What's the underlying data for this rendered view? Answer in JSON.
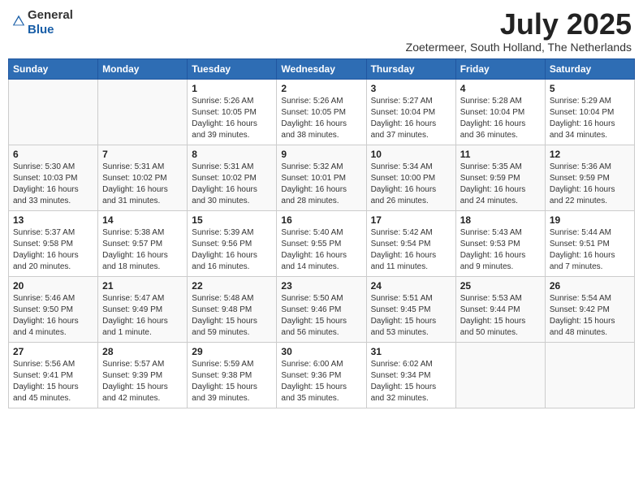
{
  "header": {
    "logo_general": "General",
    "logo_blue": "Blue",
    "month_title": "July 2025",
    "location": "Zoetermeer, South Holland, The Netherlands"
  },
  "days_of_week": [
    "Sunday",
    "Monday",
    "Tuesday",
    "Wednesday",
    "Thursday",
    "Friday",
    "Saturday"
  ],
  "weeks": [
    [
      {
        "day": "",
        "info": ""
      },
      {
        "day": "",
        "info": ""
      },
      {
        "day": "1",
        "info": "Sunrise: 5:26 AM\nSunset: 10:05 PM\nDaylight: 16 hours\nand 39 minutes."
      },
      {
        "day": "2",
        "info": "Sunrise: 5:26 AM\nSunset: 10:05 PM\nDaylight: 16 hours\nand 38 minutes."
      },
      {
        "day": "3",
        "info": "Sunrise: 5:27 AM\nSunset: 10:04 PM\nDaylight: 16 hours\nand 37 minutes."
      },
      {
        "day": "4",
        "info": "Sunrise: 5:28 AM\nSunset: 10:04 PM\nDaylight: 16 hours\nand 36 minutes."
      },
      {
        "day": "5",
        "info": "Sunrise: 5:29 AM\nSunset: 10:04 PM\nDaylight: 16 hours\nand 34 minutes."
      }
    ],
    [
      {
        "day": "6",
        "info": "Sunrise: 5:30 AM\nSunset: 10:03 PM\nDaylight: 16 hours\nand 33 minutes."
      },
      {
        "day": "7",
        "info": "Sunrise: 5:31 AM\nSunset: 10:02 PM\nDaylight: 16 hours\nand 31 minutes."
      },
      {
        "day": "8",
        "info": "Sunrise: 5:31 AM\nSunset: 10:02 PM\nDaylight: 16 hours\nand 30 minutes."
      },
      {
        "day": "9",
        "info": "Sunrise: 5:32 AM\nSunset: 10:01 PM\nDaylight: 16 hours\nand 28 minutes."
      },
      {
        "day": "10",
        "info": "Sunrise: 5:34 AM\nSunset: 10:00 PM\nDaylight: 16 hours\nand 26 minutes."
      },
      {
        "day": "11",
        "info": "Sunrise: 5:35 AM\nSunset: 9:59 PM\nDaylight: 16 hours\nand 24 minutes."
      },
      {
        "day": "12",
        "info": "Sunrise: 5:36 AM\nSunset: 9:59 PM\nDaylight: 16 hours\nand 22 minutes."
      }
    ],
    [
      {
        "day": "13",
        "info": "Sunrise: 5:37 AM\nSunset: 9:58 PM\nDaylight: 16 hours\nand 20 minutes."
      },
      {
        "day": "14",
        "info": "Sunrise: 5:38 AM\nSunset: 9:57 PM\nDaylight: 16 hours\nand 18 minutes."
      },
      {
        "day": "15",
        "info": "Sunrise: 5:39 AM\nSunset: 9:56 PM\nDaylight: 16 hours\nand 16 minutes."
      },
      {
        "day": "16",
        "info": "Sunrise: 5:40 AM\nSunset: 9:55 PM\nDaylight: 16 hours\nand 14 minutes."
      },
      {
        "day": "17",
        "info": "Sunrise: 5:42 AM\nSunset: 9:54 PM\nDaylight: 16 hours\nand 11 minutes."
      },
      {
        "day": "18",
        "info": "Sunrise: 5:43 AM\nSunset: 9:53 PM\nDaylight: 16 hours\nand 9 minutes."
      },
      {
        "day": "19",
        "info": "Sunrise: 5:44 AM\nSunset: 9:51 PM\nDaylight: 16 hours\nand 7 minutes."
      }
    ],
    [
      {
        "day": "20",
        "info": "Sunrise: 5:46 AM\nSunset: 9:50 PM\nDaylight: 16 hours\nand 4 minutes."
      },
      {
        "day": "21",
        "info": "Sunrise: 5:47 AM\nSunset: 9:49 PM\nDaylight: 16 hours\nand 1 minute."
      },
      {
        "day": "22",
        "info": "Sunrise: 5:48 AM\nSunset: 9:48 PM\nDaylight: 15 hours\nand 59 minutes."
      },
      {
        "day": "23",
        "info": "Sunrise: 5:50 AM\nSunset: 9:46 PM\nDaylight: 15 hours\nand 56 minutes."
      },
      {
        "day": "24",
        "info": "Sunrise: 5:51 AM\nSunset: 9:45 PM\nDaylight: 15 hours\nand 53 minutes."
      },
      {
        "day": "25",
        "info": "Sunrise: 5:53 AM\nSunset: 9:44 PM\nDaylight: 15 hours\nand 50 minutes."
      },
      {
        "day": "26",
        "info": "Sunrise: 5:54 AM\nSunset: 9:42 PM\nDaylight: 15 hours\nand 48 minutes."
      }
    ],
    [
      {
        "day": "27",
        "info": "Sunrise: 5:56 AM\nSunset: 9:41 PM\nDaylight: 15 hours\nand 45 minutes."
      },
      {
        "day": "28",
        "info": "Sunrise: 5:57 AM\nSunset: 9:39 PM\nDaylight: 15 hours\nand 42 minutes."
      },
      {
        "day": "29",
        "info": "Sunrise: 5:59 AM\nSunset: 9:38 PM\nDaylight: 15 hours\nand 39 minutes."
      },
      {
        "day": "30",
        "info": "Sunrise: 6:00 AM\nSunset: 9:36 PM\nDaylight: 15 hours\nand 35 minutes."
      },
      {
        "day": "31",
        "info": "Sunrise: 6:02 AM\nSunset: 9:34 PM\nDaylight: 15 hours\nand 32 minutes."
      },
      {
        "day": "",
        "info": ""
      },
      {
        "day": "",
        "info": ""
      }
    ]
  ]
}
